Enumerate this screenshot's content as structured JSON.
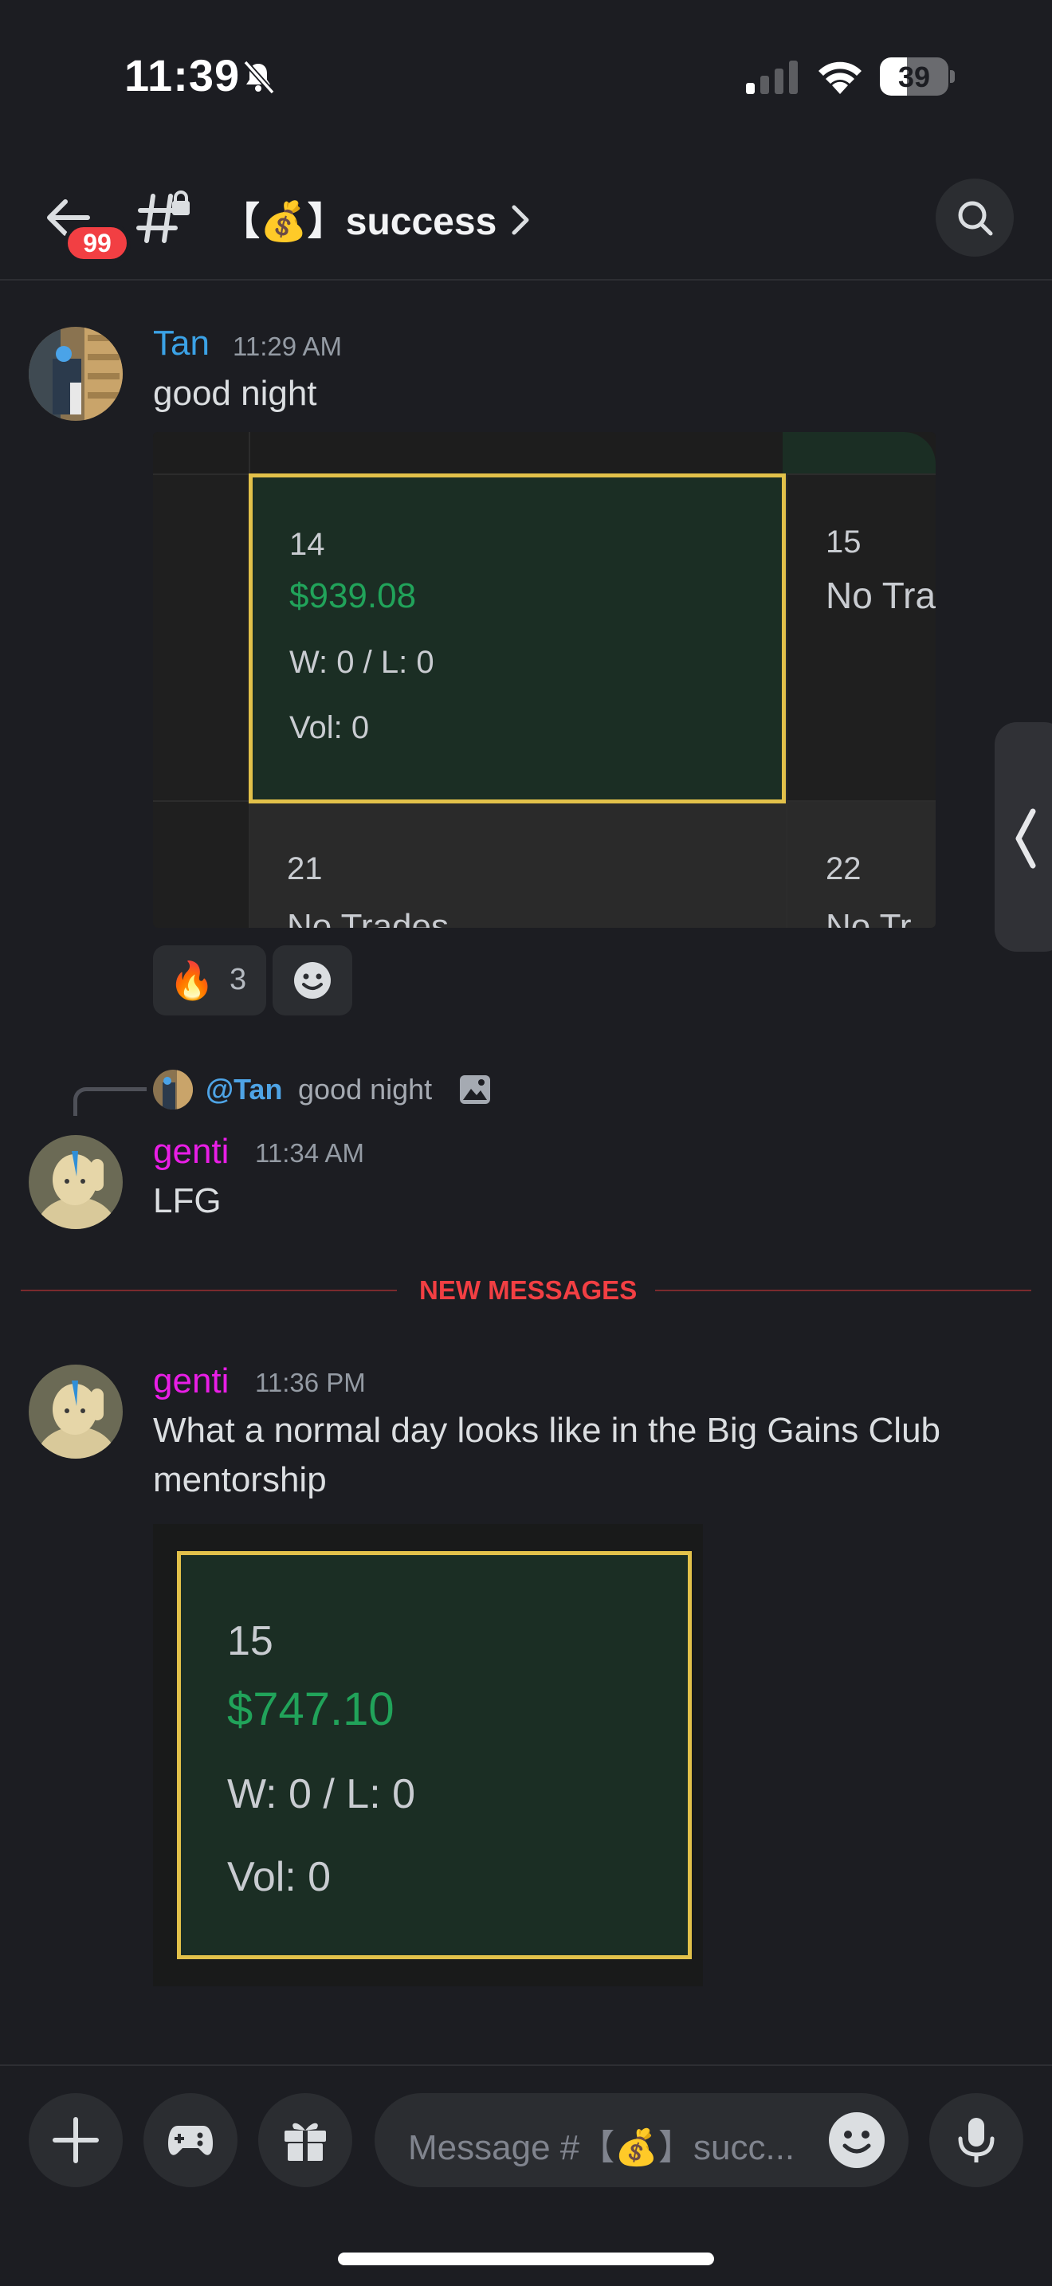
{
  "status_bar": {
    "time": "11:39",
    "battery": "39",
    "battery_level": 0.39
  },
  "header": {
    "badge": "99",
    "channel_name": "【💰】success",
    "chevron": "›"
  },
  "messages": [
    {
      "author": "Tan",
      "author_color": "#3ba2e6",
      "timestamp": "11:29 AM",
      "text": "good night",
      "attachment": {
        "cell_main": {
          "day": "14",
          "amount": "$939.08",
          "wl": "W: 0 / L: 0",
          "vol": "Vol: 0"
        },
        "cell_right": {
          "day": "15",
          "text": "No Tra"
        },
        "row2": [
          {
            "day": "21",
            "text": "No Trades"
          },
          {
            "day": "22",
            "text": "No Tr"
          }
        ]
      },
      "reactions": [
        {
          "emoji": "🔥",
          "count": "3"
        }
      ]
    },
    {
      "reply_to": {
        "mention": "@Tan",
        "text": "good night"
      },
      "author": "genti",
      "author_color": "#e91ee6",
      "timestamp": "11:34 AM",
      "text": "LFG"
    },
    {
      "author": "genti",
      "author_color": "#e91ee6",
      "timestamp": "11:36 PM",
      "text_line1": "What a normal day looks like in the Big Gains Club",
      "text_line2": "mentorship",
      "attachment": {
        "day": "15",
        "amount": "$747.10",
        "wl": "W: 0 / L: 0",
        "vol": "Vol: 0"
      }
    }
  ],
  "divider_label": "NEW MESSAGES",
  "composer": {
    "placeholder": "Message #【💰】succ..."
  }
}
